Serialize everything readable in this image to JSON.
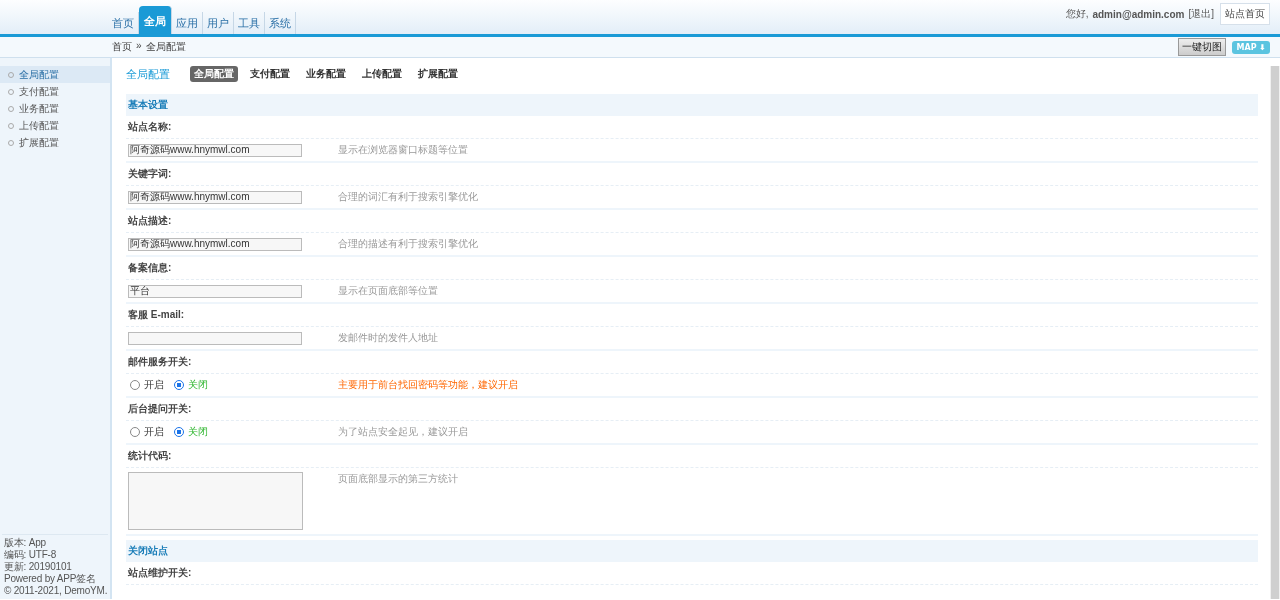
{
  "top_nav": {
    "tabs": [
      {
        "label": "首页",
        "selected": false
      },
      {
        "label": "全局",
        "selected": true
      },
      {
        "label": "应用",
        "selected": false
      },
      {
        "label": "用户",
        "selected": false
      },
      {
        "label": "工具",
        "selected": false
      },
      {
        "label": "系统",
        "selected": false
      }
    ],
    "greeting": "您好,",
    "user": "admin@admin.com",
    "logout": "[退出]",
    "site_home": "站点首页"
  },
  "breadcrumb": {
    "home": "首页",
    "separator": "»",
    "current": "全局配置"
  },
  "toolbar": {
    "one_click": "一键切图",
    "map": "MAP ⬇"
  },
  "sidebar": {
    "items": [
      {
        "label": "全局配置",
        "selected": true
      },
      {
        "label": "支付配置",
        "selected": false
      },
      {
        "label": "业务配置",
        "selected": false
      },
      {
        "label": "上传配置",
        "selected": false
      },
      {
        "label": "扩展配置",
        "selected": false
      }
    ],
    "footer": [
      "版本: App",
      "编码: UTF-8",
      "更新: 20190101",
      "Powered by APP签名",
      "© 2011-2021, DemoYM."
    ]
  },
  "page_title": "全局配置",
  "sub_tabs": [
    {
      "label": "全局配置",
      "selected": true
    },
    {
      "label": "支付配置",
      "selected": false
    },
    {
      "label": "业务配置",
      "selected": false
    },
    {
      "label": "上传配置",
      "selected": false
    },
    {
      "label": "扩展配置",
      "selected": false
    }
  ],
  "sections": [
    {
      "title": "基本设置",
      "fields": [
        {
          "kind": "text",
          "label": "站点名称:",
          "value": "阿奇源码www.hnymwl.com",
          "hint": "显示在浏览器窗口标题等位置",
          "warning": false
        },
        {
          "kind": "text",
          "label": "关键字词:",
          "value": "阿奇源码www.hnymwl.com",
          "hint": "合理的词汇有利于搜索引擎优化",
          "warning": false
        },
        {
          "kind": "text",
          "label": "站点描述:",
          "value": "阿奇源码www.hnymwl.com",
          "hint": "合理的描述有利于搜索引擎优化",
          "warning": false
        },
        {
          "kind": "text",
          "label": "备案信息:",
          "value": "平台",
          "hint": "显示在页面底部等位置",
          "warning": false
        },
        {
          "kind": "text",
          "label": "客服 E-mail:",
          "hint": "发邮件时的发件人地址",
          "warning": false
        },
        {
          "kind": "radio",
          "label": "邮件服务开关:",
          "options": [
            {
              "label": "开启",
              "selected": false
            },
            {
              "label": "关闭",
              "selected": true
            }
          ],
          "hint": "主要用于前台找回密码等功能，建议开启",
          "warning": true
        },
        {
          "kind": "radio",
          "label": "后台提问开关:",
          "options": [
            {
              "label": "开启",
              "selected": false
            },
            {
              "label": "关闭",
              "selected": true
            }
          ],
          "hint": "为了站点安全起见，建议开启",
          "warning": false
        },
        {
          "kind": "textarea",
          "label": "统计代码:",
          "hint": "页面底部显示的第三方统计",
          "warning": false
        }
      ]
    },
    {
      "title": "关闭站点",
      "fields": [
        {
          "kind": "label",
          "label": "站点维护开关:"
        }
      ]
    }
  ]
}
